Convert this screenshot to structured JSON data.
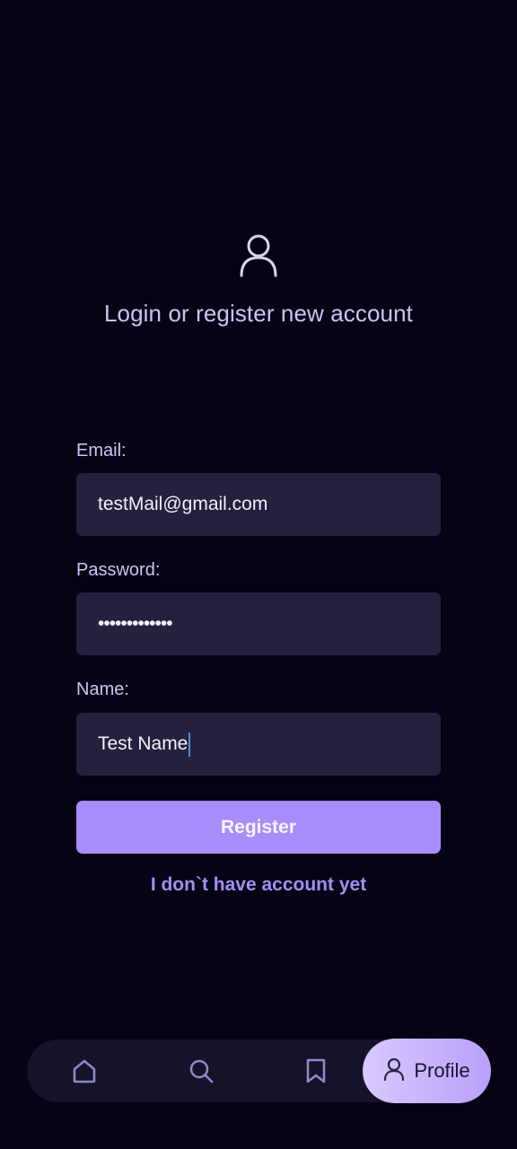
{
  "header": {
    "icon": "user-icon",
    "title": "Login or register new account"
  },
  "form": {
    "email": {
      "label": "Email:",
      "value": "testMail@gmail.com"
    },
    "password": {
      "label": "Password:",
      "value": "•••••••••••••"
    },
    "name": {
      "label": "Name:",
      "value": "Test Name"
    },
    "submit_label": "Register",
    "switch_link": "I don`t have account yet"
  },
  "bottom_nav": {
    "items": [
      {
        "icon": "home-icon"
      },
      {
        "icon": "search-icon"
      },
      {
        "icon": "bookmark-icon"
      },
      {
        "icon": "user-icon",
        "label": "Profile",
        "active": true
      }
    ]
  },
  "colors": {
    "background": "#050314",
    "field_background": "#23213d",
    "accent": "#a98cfb",
    "label_text": "#cfc3f5"
  }
}
